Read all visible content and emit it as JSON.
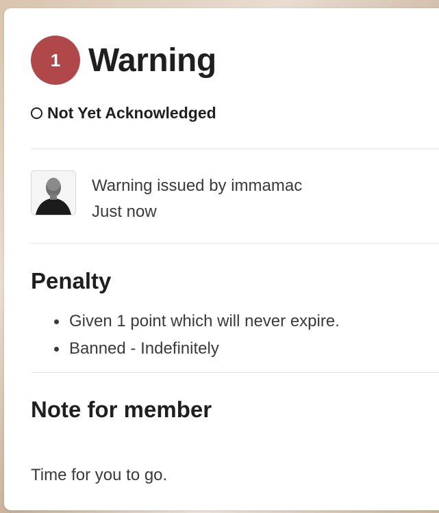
{
  "warning": {
    "count": "1",
    "title": "Warning",
    "acknowledgement_status": "Not Yet Acknowledged",
    "issued_by_text": "Warning issued by immamac",
    "issued_time": "Just now"
  },
  "penalty": {
    "heading": "Penalty",
    "items": [
      "Given 1 point which will never expire.",
      "Banned - Indefinitely"
    ]
  },
  "note": {
    "heading": "Note for member",
    "text": "Time for you to go."
  },
  "colors": {
    "badge": "#b0484a",
    "text": "#1f1f1f",
    "muted_text": "#3a3a3a",
    "divider": "#e3e3e3"
  },
  "icons": {
    "status": "empty-circle-icon",
    "issuer_avatar": "avatar"
  }
}
